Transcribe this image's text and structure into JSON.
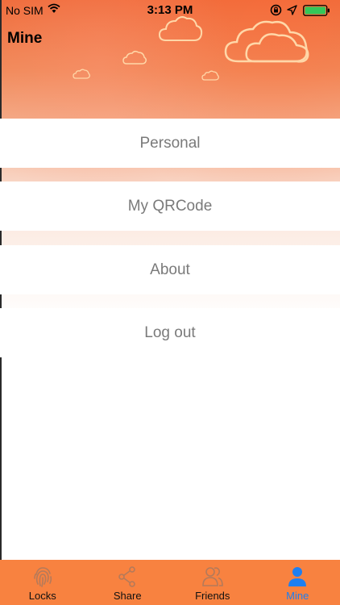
{
  "status_bar": {
    "carrier": "No SIM",
    "time": "3:13 PM"
  },
  "header": {
    "title": "Mine"
  },
  "menu": {
    "items": [
      {
        "label": "Personal"
      },
      {
        "label": "My QRCode"
      },
      {
        "label": "About"
      },
      {
        "label": "Log out"
      }
    ]
  },
  "tab_bar": {
    "active": "Mine",
    "active_color": "#1f7ff0",
    "background": "#f88240",
    "tabs": [
      {
        "label": "Locks",
        "icon": "fingerprint-icon"
      },
      {
        "label": "Share",
        "icon": "share-icon"
      },
      {
        "label": "Friends",
        "icon": "friends-icon"
      },
      {
        "label": "Mine",
        "icon": "person-icon"
      }
    ]
  }
}
